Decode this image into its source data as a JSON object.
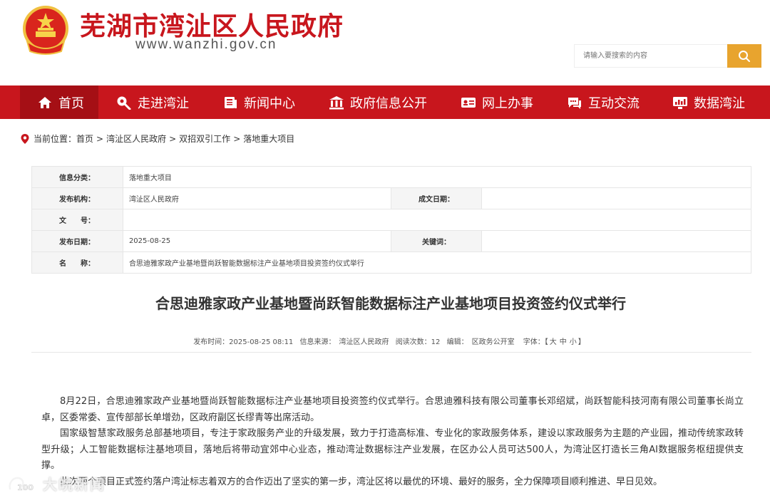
{
  "header": {
    "site_title": "芜湖市湾沚区人民政府",
    "site_url": "www.wanzhi.gov.cn",
    "search_placeholder": "请输入要搜索的内容",
    "brand_color": "#c8161d",
    "search_button_color": "#e8a42e"
  },
  "nav": {
    "items": [
      {
        "label": "首页",
        "icon": "home-icon"
      },
      {
        "label": "走进湾沚",
        "icon": "location-icon"
      },
      {
        "label": "新闻中心",
        "icon": "news-icon"
      },
      {
        "label": "政府信息公开",
        "icon": "government-icon"
      },
      {
        "label": "网上办事",
        "icon": "id-card-icon"
      },
      {
        "label": "互动交流",
        "icon": "chat-icon"
      },
      {
        "label": "数据湾沚",
        "icon": "data-icon"
      }
    ]
  },
  "breadcrumb": {
    "prefix": "当前位置：",
    "items": [
      "首页",
      "湾沚区人民政府",
      "双招双引工作",
      "落地重大项目"
    ]
  },
  "info": {
    "category_label": "信息分类：",
    "category_value": "落地重大项目",
    "publisher_label": "发布机构：",
    "publisher_value": "湾沚区人民政府",
    "created_label": "成文日期：",
    "created_value": "",
    "docno_label": "文　　号：",
    "docno_value": "",
    "pubdate_label": "发布日期：",
    "pubdate_value": "2025-08-25",
    "keywords_label": "关键词：",
    "keywords_value": "",
    "name_label": "名　　称：",
    "name_value": "合思迪雅家政产业基地暨尚跃智能数据标注产业基地项目投资签约仪式举行"
  },
  "article": {
    "title": "合思迪雅家政产业基地暨尚跃智能数据标注产业基地项目投资签约仪式举行",
    "meta": {
      "time": "发布时间：2025-08-25 08:11",
      "source": "信息来源：　湾沚区人民政府",
      "views": "阅读次数：12",
      "editor": "编辑：　区政务公开室",
      "font_label": "字体：",
      "font_open": "【",
      "font_large": "大",
      "font_medium": "中",
      "font_small": "小",
      "font_close": "】"
    },
    "paragraphs": [
      "8月22日，合思迪雅家政产业基地暨尚跃智能数据标注产业基地项目投资签约仪式举行。合思迪雅科技有限公司董事长邓绍斌，尚跃智能科技河南有限公司董事长尚立卓，区委常委、宣传部部长单增劲，区政府副区长缪青等出席活动。",
      "国家级智慧家政服务总部基地项目，专注于家政服务产业的升级发展，致力于打造高标准、专业化的家政服务体系，建设以家政服务为主题的产业园，推动传统家政转型升级；人工智能数据标注基地项目，落地后将带动宜郊中心业态，推动湾沚数据标注产业发展，在区办公人员可达500人，为湾沚区打造长三角AI数据服务枢纽提供支撑。",
      "此次两个项目正式签约落户湾沚标志着双方的合作迈出了坚实的第一步，湾沚区将以最优的环境、最好的服务，全力保障项目顺利推进、早日见效。"
    ]
  },
  "watermark": {
    "text": "大皖新闻"
  }
}
